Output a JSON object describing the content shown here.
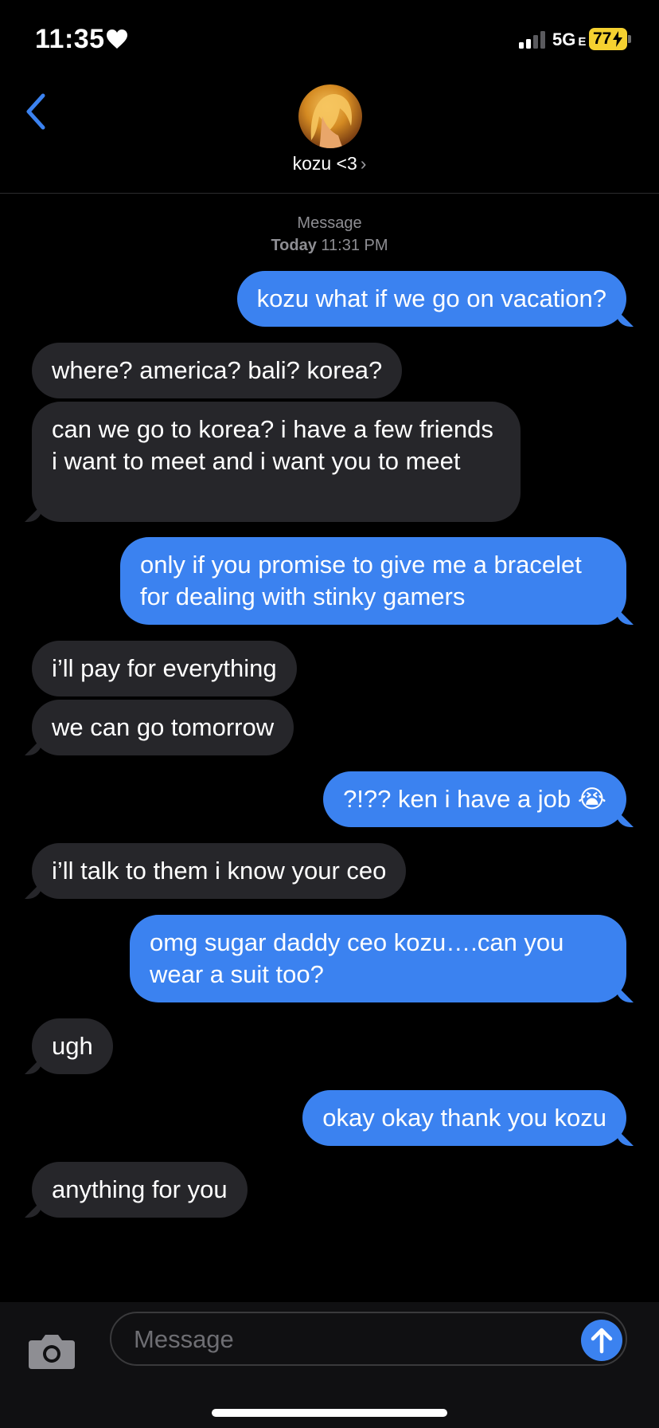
{
  "status_bar": {
    "time": "11:35",
    "network": "5G",
    "network_suffix": "E",
    "battery": "77"
  },
  "header": {
    "contact_name": "kozu <3",
    "chevron": "›"
  },
  "thread_meta": {
    "service": "Message",
    "day": "Today",
    "time": "11:31 PM"
  },
  "messages": [
    {
      "from": "me",
      "text": "kozu what if we go on vacation?"
    },
    {
      "from": "them",
      "text": "where? america? bali? korea?"
    },
    {
      "from": "them",
      "text": "can we go to korea? i have a few friends i want to meet and i want you to meet"
    },
    {
      "from": "me",
      "text": "only if you promise to give me a bracelet for dealing with stinky gamers"
    },
    {
      "from": "them",
      "text": "i’ll pay for everything"
    },
    {
      "from": "them",
      "text": "we can go tomorrow"
    },
    {
      "from": "me",
      "text": "?!?? ken i have a job 😭"
    },
    {
      "from": "them",
      "text": "i’ll talk to them i know your ceo"
    },
    {
      "from": "me",
      "text": "omg sugar daddy ceo kozu….can you wear a suit too?"
    },
    {
      "from": "them",
      "text": "ugh"
    },
    {
      "from": "me",
      "text": "okay okay thank you kozu"
    },
    {
      "from": "them",
      "text": "anything for you"
    }
  ],
  "composer": {
    "placeholder": "Message"
  },
  "icons": {
    "heart": "heart-icon",
    "back": "chevron-left-icon",
    "camera": "camera-icon",
    "send": "arrow-up-icon"
  },
  "colors": {
    "outgoing_bubble": "#3b82f0",
    "incoming_bubble": "#26262a",
    "accent": "#3b82f0",
    "battery": "#f5d130"
  }
}
